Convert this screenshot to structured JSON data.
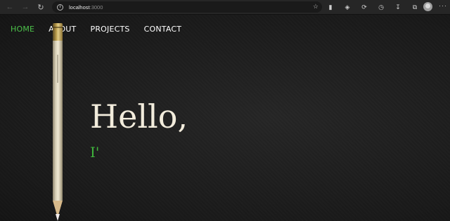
{
  "browser": {
    "url_host": "localhost",
    "url_port": ":3000",
    "icons": {
      "back": "back-arrow-icon",
      "forward": "forward-arrow-icon",
      "reload": "reload-icon",
      "info": "site-info-icon",
      "favorite": "add-favorite-icon",
      "reading": "reading-list-icon",
      "extension": "extension-icon",
      "refresh_ext": "sync-icon",
      "history": "history-icon",
      "downloads": "download-icon",
      "collections": "collections-icon",
      "profile": "profile-avatar",
      "more": "more-options-icon"
    }
  },
  "nav": {
    "items": [
      {
        "label": "HOME",
        "active": true
      },
      {
        "label": "ABOUT",
        "active": false
      },
      {
        "label": "PROJECTS",
        "active": false
      },
      {
        "label": "CONTACT",
        "active": false
      }
    ]
  },
  "hero": {
    "greeting": "Hello,",
    "typed_text": "I'"
  },
  "colors": {
    "accent": "#4cc14a",
    "background": "#1b1b1b",
    "greeting": "#f2ecdc"
  }
}
